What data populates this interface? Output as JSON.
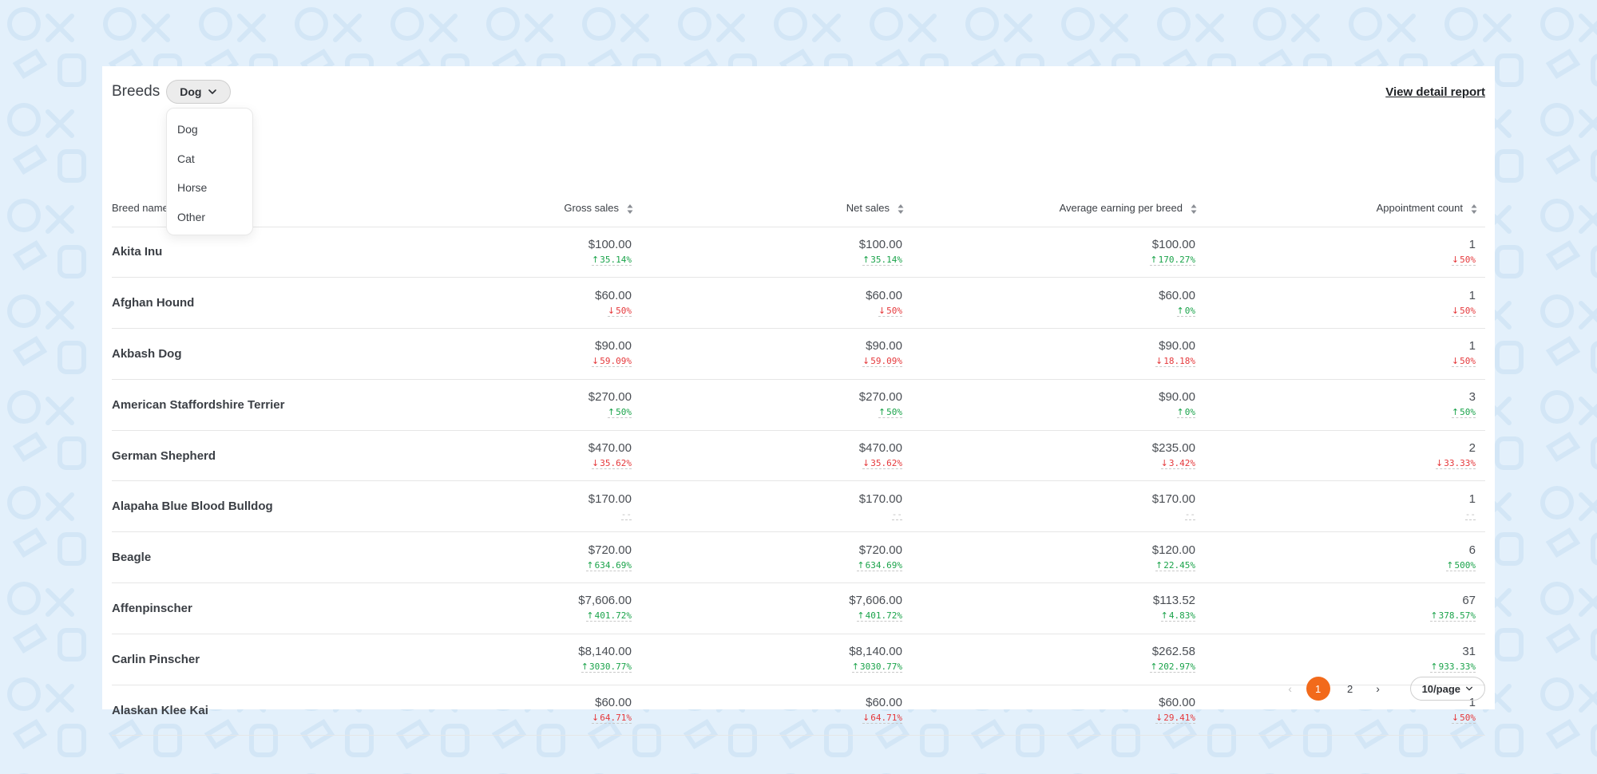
{
  "header": {
    "title": "Breeds",
    "filter_value": "Dog",
    "detail_link": "View detail report"
  },
  "dropdown": {
    "options": [
      "Dog",
      "Cat",
      "Horse",
      "Other"
    ]
  },
  "table": {
    "columns": [
      "Breed name",
      "Gross sales",
      "Net sales",
      "Average earning per breed",
      "Appointment count"
    ],
    "rows": [
      {
        "name": "Akita Inu",
        "cells": [
          {
            "v": "$100.00",
            "c": "35.14%",
            "d": "up"
          },
          {
            "v": "$100.00",
            "c": "35.14%",
            "d": "up"
          },
          {
            "v": "$100.00",
            "c": "170.27%",
            "d": "up"
          },
          {
            "v": "1",
            "c": "50%",
            "d": "down"
          }
        ]
      },
      {
        "name": "Afghan Hound",
        "cells": [
          {
            "v": "$60.00",
            "c": "50%",
            "d": "down"
          },
          {
            "v": "$60.00",
            "c": "50%",
            "d": "down"
          },
          {
            "v": "$60.00",
            "c": "0%",
            "d": "up"
          },
          {
            "v": "1",
            "c": "50%",
            "d": "down"
          }
        ]
      },
      {
        "name": "Akbash Dog",
        "cells": [
          {
            "v": "$90.00",
            "c": "59.09%",
            "d": "down"
          },
          {
            "v": "$90.00",
            "c": "59.09%",
            "d": "down"
          },
          {
            "v": "$90.00",
            "c": "18.18%",
            "d": "down"
          },
          {
            "v": "1",
            "c": "50%",
            "d": "down"
          }
        ]
      },
      {
        "name": "American Staffordshire Terrier",
        "cells": [
          {
            "v": "$270.00",
            "c": "50%",
            "d": "up"
          },
          {
            "v": "$270.00",
            "c": "50%",
            "d": "up"
          },
          {
            "v": "$90.00",
            "c": "0%",
            "d": "up"
          },
          {
            "v": "3",
            "c": "50%",
            "d": "up"
          }
        ]
      },
      {
        "name": "German Shepherd",
        "cells": [
          {
            "v": "$470.00",
            "c": "35.62%",
            "d": "down"
          },
          {
            "v": "$470.00",
            "c": "35.62%",
            "d": "down"
          },
          {
            "v": "$235.00",
            "c": "3.42%",
            "d": "down"
          },
          {
            "v": "2",
            "c": "33.33%",
            "d": "down"
          }
        ]
      },
      {
        "name": "Alapaha Blue Blood Bulldog",
        "cells": [
          {
            "v": "$170.00",
            "c": "--",
            "d": "none"
          },
          {
            "v": "$170.00",
            "c": "--",
            "d": "none"
          },
          {
            "v": "$170.00",
            "c": "--",
            "d": "none"
          },
          {
            "v": "1",
            "c": "--",
            "d": "none"
          }
        ]
      },
      {
        "name": "Beagle",
        "cells": [
          {
            "v": "$720.00",
            "c": "634.69%",
            "d": "up"
          },
          {
            "v": "$720.00",
            "c": "634.69%",
            "d": "up"
          },
          {
            "v": "$120.00",
            "c": "22.45%",
            "d": "up"
          },
          {
            "v": "6",
            "c": "500%",
            "d": "up"
          }
        ]
      },
      {
        "name": "Affenpinscher",
        "cells": [
          {
            "v": "$7,606.00",
            "c": "401.72%",
            "d": "up"
          },
          {
            "v": "$7,606.00",
            "c": "401.72%",
            "d": "up"
          },
          {
            "v": "$113.52",
            "c": "4.83%",
            "d": "up"
          },
          {
            "v": "67",
            "c": "378.57%",
            "d": "up"
          }
        ]
      },
      {
        "name": "Carlin Pinscher",
        "cells": [
          {
            "v": "$8,140.00",
            "c": "3030.77%",
            "d": "up"
          },
          {
            "v": "$8,140.00",
            "c": "3030.77%",
            "d": "up"
          },
          {
            "v": "$262.58",
            "c": "202.97%",
            "d": "up"
          },
          {
            "v": "31",
            "c": "933.33%",
            "d": "up"
          }
        ]
      },
      {
        "name": "Alaskan Klee Kai",
        "cells": [
          {
            "v": "$60.00",
            "c": "64.71%",
            "d": "down"
          },
          {
            "v": "$60.00",
            "c": "64.71%",
            "d": "down"
          },
          {
            "v": "$60.00",
            "c": "29.41%",
            "d": "down"
          },
          {
            "v": "1",
            "c": "50%",
            "d": "down"
          }
        ]
      }
    ]
  },
  "pagination": {
    "pages": [
      "1",
      "2"
    ],
    "current_page": "1",
    "page_size": "10/page"
  },
  "colors": {
    "up": "#1aa34a",
    "down": "#e5383b",
    "accent": "#f26a1b",
    "background": "#e3f0fb"
  },
  "icons": [
    "chevron-down-icon",
    "sort-icon",
    "arrow-up-icon",
    "arrow-down-icon",
    "chevron-left-icon",
    "chevron-right-icon"
  ]
}
